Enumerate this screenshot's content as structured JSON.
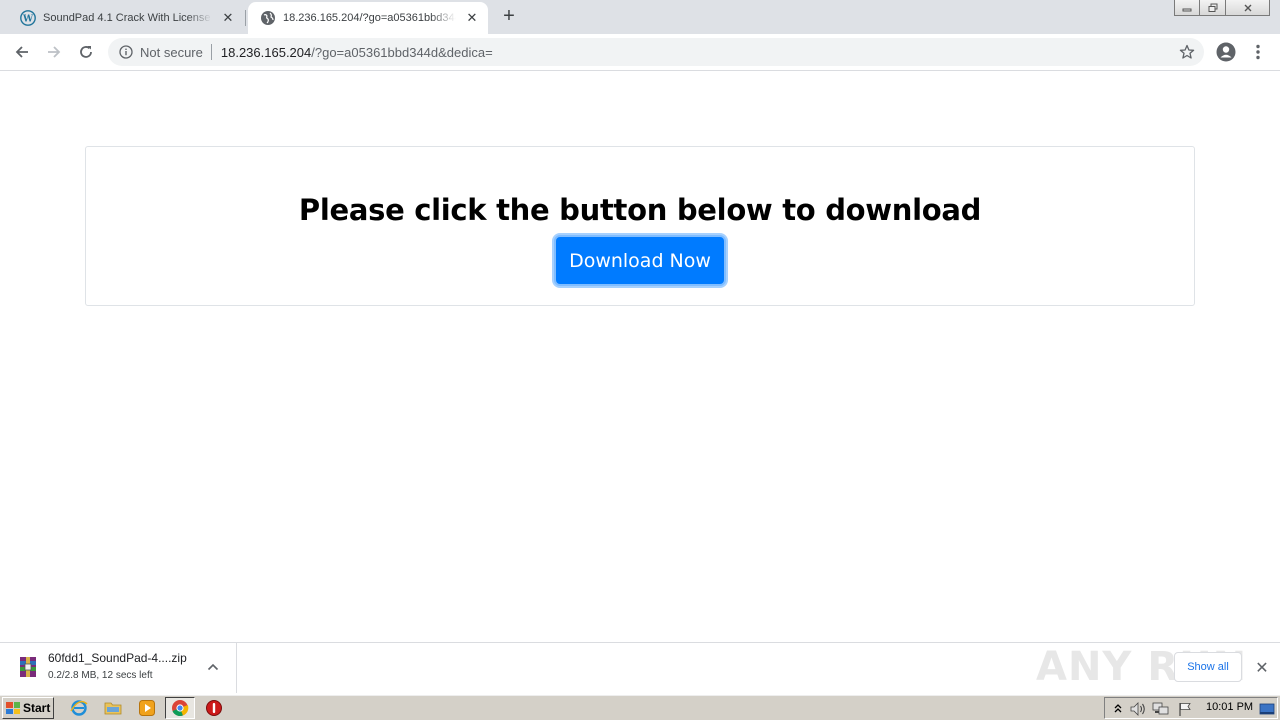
{
  "browser": {
    "tabs": [
      {
        "title": "SoundPad 4.1 Crack With License Key",
        "favicon": "wordpress-icon",
        "active": false
      },
      {
        "title": "18.236.165.204/?go=a05361bbd344d&dedica=",
        "favicon": "globe-icon",
        "active": true
      }
    ],
    "new_tab_label": "+",
    "close_glyph": "✕"
  },
  "toolbar": {
    "security_label": "Not secure",
    "url_host": "18.236.165.204",
    "url_path": "/?go=a05361bbd344d&dedica="
  },
  "page": {
    "heading": "Please click the button below to download",
    "download_button": "Download Now",
    "accent_color": "#007bff"
  },
  "download_shelf": {
    "filename": "60fdd1_SoundPad-4....zip",
    "status": "0.2/2.8 MB, 12 secs left",
    "show_all": "Show all",
    "watermark": "ANY RUN"
  },
  "taskbar": {
    "start_label": "Start",
    "clock": "10:01 PM",
    "pinned": [
      "ie-icon",
      "explorer-folder-icon",
      "media-player-icon",
      "chrome-icon",
      "stop-icon"
    ]
  }
}
